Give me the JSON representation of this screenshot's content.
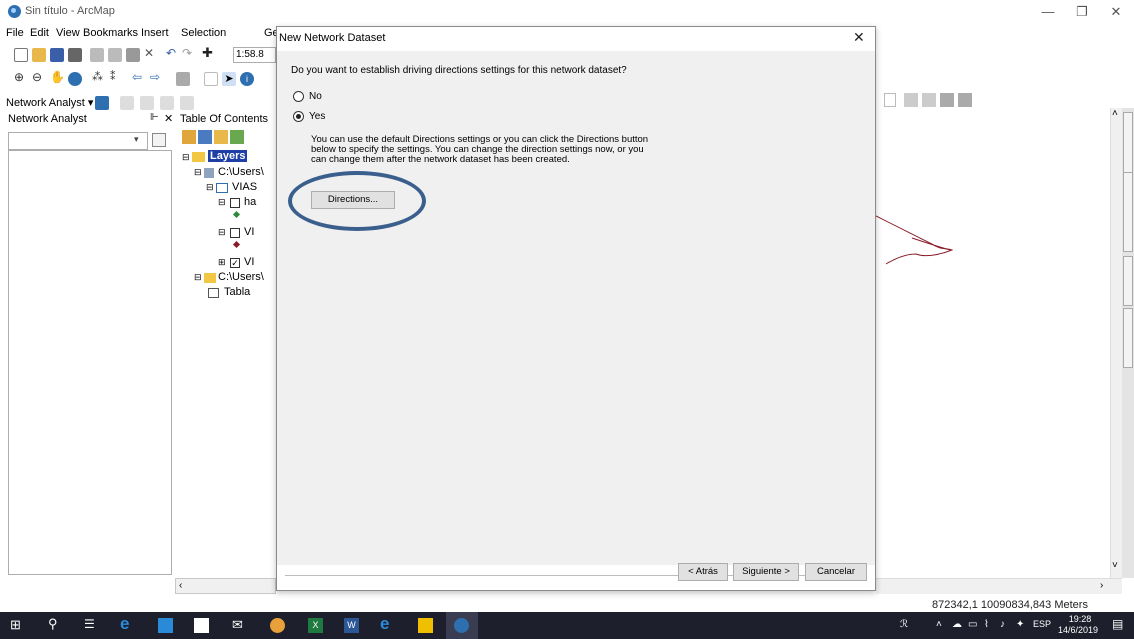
{
  "window": {
    "title": "Sin título - ArcMap"
  },
  "menu": [
    "File",
    "Edit",
    "View",
    "Bookmarks",
    "Insert",
    "Selection",
    "Ge"
  ],
  "toolbar": {
    "scale": "1:58.8",
    "network_analyst_label": "Network Analyst ▾"
  },
  "panels": {
    "network_analyst_title": "Network Analyst",
    "toc_title": "Table Of Contents",
    "toc_items": [
      "Layers",
      "C:\\Users\\",
      "VIAS",
      "ha",
      "VI",
      "VI",
      "C:\\Users\\",
      "Tabla"
    ]
  },
  "dialog": {
    "title": "New Network Dataset",
    "question": "Do you want to establish driving directions settings for this network dataset?",
    "option_no": "No",
    "option_yes": "Yes",
    "selected": "Yes",
    "info_text": "You can use the default Directions settings or you can click the Directions button below to specify the settings. You can change the direction settings now, or you can change them after the network dataset has been created.",
    "directions_button": "Directions...",
    "back_button": "< Atrás",
    "next_button": "Siguiente >",
    "cancel_button": "Cancelar"
  },
  "status_bar": {
    "coordinates": "872342,1  10090834,843 Meters"
  },
  "taskbar": {
    "language": "ESP",
    "time": "19:28",
    "date": "14/6/2019"
  },
  "colors": {
    "highlight_oval": "#3b5f8c",
    "taskbar": "#1d1f2c",
    "layers_folder": "#f2c744"
  }
}
